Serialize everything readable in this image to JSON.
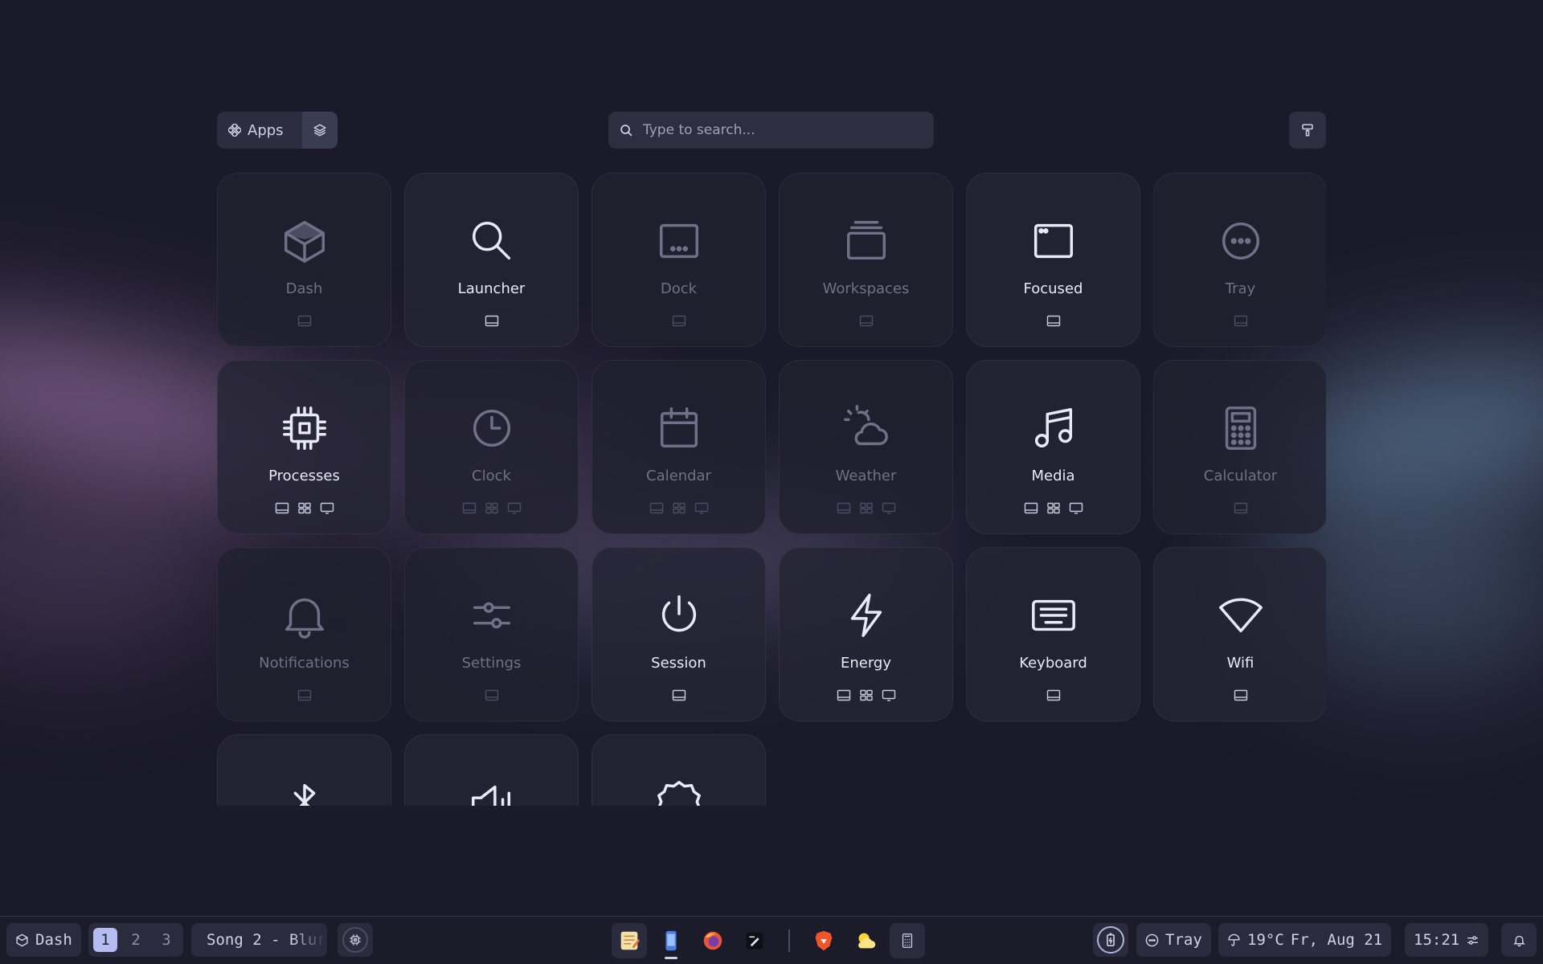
{
  "header": {
    "mode_label": "Apps",
    "search_placeholder": "Type to search..."
  },
  "tiles": [
    {
      "label": "Dash",
      "icon": "cube-icon",
      "active": false,
      "badges": [
        "panel-icon"
      ]
    },
    {
      "label": "Launcher",
      "icon": "search-icon",
      "active": true,
      "badges": [
        "panel-icon"
      ]
    },
    {
      "label": "Dock",
      "icon": "dock-icon",
      "active": false,
      "badges": [
        "panel-icon"
      ]
    },
    {
      "label": "Workspaces",
      "icon": "stack-icon",
      "active": false,
      "badges": [
        "panel-icon"
      ]
    },
    {
      "label": "Focused",
      "icon": "window-icon",
      "active": true,
      "badges": [
        "panel-icon"
      ]
    },
    {
      "label": "Tray",
      "icon": "dots-circle-icon",
      "active": false,
      "badges": [
        "panel-icon"
      ]
    },
    {
      "label": "Processes",
      "icon": "cpu-icon",
      "active": true,
      "badges": [
        "panel-icon",
        "grid-icon",
        "monitor-icon"
      ]
    },
    {
      "label": "Clock",
      "icon": "clock-icon",
      "active": false,
      "badges": [
        "panel-icon",
        "grid-icon",
        "monitor-icon"
      ]
    },
    {
      "label": "Calendar",
      "icon": "calendar-icon",
      "active": false,
      "badges": [
        "panel-icon",
        "grid-icon",
        "monitor-icon"
      ]
    },
    {
      "label": "Weather",
      "icon": "weather-icon",
      "active": false,
      "badges": [
        "panel-icon",
        "grid-icon",
        "monitor-icon"
      ]
    },
    {
      "label": "Media",
      "icon": "music-icon",
      "active": true,
      "badges": [
        "panel-icon",
        "grid-icon",
        "monitor-icon"
      ]
    },
    {
      "label": "Calculator",
      "icon": "calculator-icon",
      "active": false,
      "badges": [
        "panel-icon"
      ]
    },
    {
      "label": "Notifications",
      "icon": "bell-icon",
      "active": false,
      "badges": [
        "panel-icon"
      ]
    },
    {
      "label": "Settings",
      "icon": "sliders-icon",
      "active": false,
      "badges": [
        "panel-icon"
      ]
    },
    {
      "label": "Session",
      "icon": "power-icon",
      "active": true,
      "badges": [
        "panel-icon"
      ]
    },
    {
      "label": "Energy",
      "icon": "bolt-icon",
      "active": true,
      "badges": [
        "panel-icon",
        "grid-icon",
        "monitor-icon"
      ]
    },
    {
      "label": "Keyboard",
      "icon": "keyboard-icon",
      "active": true,
      "badges": [
        "panel-icon"
      ]
    },
    {
      "label": "Wifi",
      "icon": "wifi-icon",
      "active": true,
      "badges": [
        "panel-icon"
      ]
    },
    {
      "label": "",
      "icon": "bluetooth-icon",
      "active": true,
      "badges": []
    },
    {
      "label": "",
      "icon": "volume-icon",
      "active": true,
      "badges": []
    },
    {
      "label": "",
      "icon": "badge-icon",
      "active": true,
      "badges": []
    }
  ],
  "taskbar": {
    "dash_label": "Dash",
    "workspaces": [
      "1",
      "2",
      "3"
    ],
    "active_workspace": "1",
    "media_text": "Song 2 - Blur",
    "dock_apps": [
      {
        "name": "text-editor-icon",
        "boxed": true,
        "running": false
      },
      {
        "name": "phone-app-icon",
        "boxed": false,
        "running": true
      },
      {
        "name": "firefox-icon",
        "boxed": false,
        "running": false
      },
      {
        "name": "notes-app-icon",
        "boxed": false,
        "running": false
      },
      {
        "name": "brave-icon",
        "boxed": false,
        "running": false
      },
      {
        "name": "weather-app-icon",
        "boxed": false,
        "running": false
      },
      {
        "name": "calculator-app-icon",
        "boxed": true,
        "running": false
      }
    ],
    "tray_label": "Tray",
    "weather_text": "19°C",
    "date_text": "Fr, Aug 21",
    "time_text": "15:21"
  }
}
